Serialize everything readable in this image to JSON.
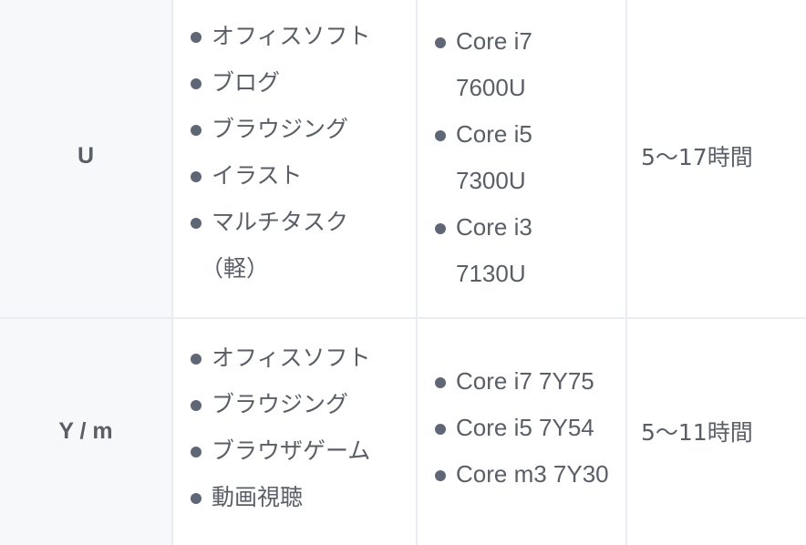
{
  "rows": [
    {
      "series": "U",
      "uses": [
        "オフィスソフト",
        "ブログ",
        "ブラウジング",
        "イラスト",
        "マルチタスク",
        "（軽）"
      ],
      "cpus": [
        {
          "line1": "Core i7",
          "line2": "7600U"
        },
        {
          "line1": "Core i5",
          "line2": "7300U"
        },
        {
          "line1": "Core i3",
          "line2": "7130U"
        }
      ],
      "battery": "5〜17時間"
    },
    {
      "series": "Y / m",
      "uses": [
        "オフィスソフト",
        "ブラウジング",
        "ブラウザゲーム",
        "動画視聴"
      ],
      "cpus": [
        "Core i7 7Y75",
        "Core i5 7Y54",
        "Core m3 7Y30"
      ],
      "battery": "5〜11時間"
    }
  ],
  "colors": {
    "text": "#5a5e66",
    "bullet": "#5f6675",
    "header_bg": "#f7f8fa",
    "border": "#e9ecf0"
  },
  "icons": {
    "bullet": "bullet-dot-icon"
  }
}
